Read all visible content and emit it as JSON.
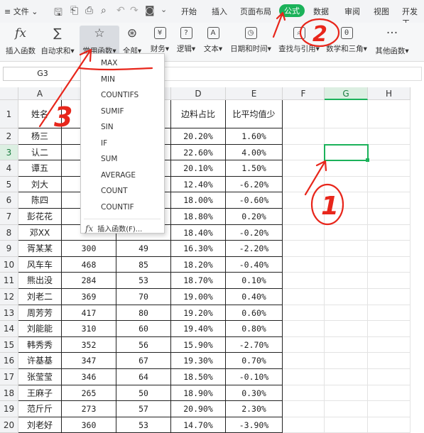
{
  "menubar": {
    "file_label": "文件",
    "tabs": [
      "开始",
      "插入",
      "页面布局",
      "公式",
      "数据",
      "审阅",
      "视图",
      "开发工"
    ],
    "active_tab": "公式"
  },
  "ribbon": {
    "buttons": [
      {
        "label": "插入函数",
        "icon": "fx"
      },
      {
        "label": "自动求和",
        "icon": "∑"
      },
      {
        "label": "常用函数",
        "icon": "☆"
      },
      {
        "label": "全部",
        "icon": "⊛"
      },
      {
        "label": "财务",
        "icon": "¥"
      },
      {
        "label": "逻辑",
        "icon": "?"
      },
      {
        "label": "文本",
        "icon": "A"
      },
      {
        "label": "日期和时间",
        "icon": "◷"
      },
      {
        "label": "查找与引用",
        "icon": "⌕"
      },
      {
        "label": "数学和三角",
        "icon": "θ"
      },
      {
        "label": "其他函数",
        "icon": "···"
      }
    ]
  },
  "formula_bar": {
    "name_box": "G3",
    "formula": ""
  },
  "columns": [
    "A",
    "B",
    "C",
    "D",
    "E",
    "F",
    "G",
    "H"
  ],
  "selected_column": "G",
  "selected_row": "3",
  "headers": {
    "a1": "姓名",
    "d1": "边料占比",
    "e1": "比平均值少"
  },
  "rows": [
    {
      "num": "2",
      "name": "杨三",
      "b": "",
      "c": "",
      "d": "20.20%",
      "e": "1.60%"
    },
    {
      "num": "3",
      "name": "认二",
      "b": "",
      "c": "",
      "d": "22.60%",
      "e": "4.00%"
    },
    {
      "num": "4",
      "name": "谭五",
      "b": "",
      "c": "",
      "d": "20.10%",
      "e": "1.50%"
    },
    {
      "num": "5",
      "name": "刘大",
      "b": "",
      "c": "",
      "d": "12.40%",
      "e": "-6.20%"
    },
    {
      "num": "6",
      "name": "陈四",
      "b": "",
      "c": "",
      "d": "18.00%",
      "e": "-0.60%"
    },
    {
      "num": "7",
      "name": "彭花花",
      "b": "",
      "c": "",
      "d": "18.80%",
      "e": "0.20%"
    },
    {
      "num": "8",
      "name": "邓XX",
      "b": "",
      "c": "",
      "d": "18.40%",
      "e": "-0.20%"
    },
    {
      "num": "9",
      "name": "胥某某",
      "b": "300",
      "c": "49",
      "d": "16.30%",
      "e": "-2.20%"
    },
    {
      "num": "10",
      "name": "风车车",
      "b": "468",
      "c": "85",
      "d": "18.20%",
      "e": "-0.40%"
    },
    {
      "num": "11",
      "name": "熊出没",
      "b": "284",
      "c": "53",
      "d": "18.70%",
      "e": "0.10%"
    },
    {
      "num": "12",
      "name": "刘老二",
      "b": "369",
      "c": "70",
      "d": "19.00%",
      "e": "0.40%"
    },
    {
      "num": "13",
      "name": "周芳芳",
      "b": "417",
      "c": "80",
      "d": "19.20%",
      "e": "0.60%"
    },
    {
      "num": "14",
      "name": "刘能能",
      "b": "310",
      "c": "60",
      "d": "19.40%",
      "e": "0.80%"
    },
    {
      "num": "15",
      "name": "韩秀秀",
      "b": "352",
      "c": "56",
      "d": "15.90%",
      "e": "-2.70%"
    },
    {
      "num": "16",
      "name": "许基基",
      "b": "347",
      "c": "67",
      "d": "19.30%",
      "e": "0.70%"
    },
    {
      "num": "17",
      "name": "张莹莹",
      "b": "346",
      "c": "64",
      "d": "18.50%",
      "e": "-0.10%"
    },
    {
      "num": "18",
      "name": "王麻子",
      "b": "265",
      "c": "50",
      "d": "18.90%",
      "e": "0.30%"
    },
    {
      "num": "19",
      "name": "范斤斤",
      "b": "273",
      "c": "57",
      "d": "20.90%",
      "e": "2.30%"
    },
    {
      "num": "20",
      "name": "刘老好",
      "b": "360",
      "c": "53",
      "d": "14.70%",
      "e": "-3.90%"
    }
  ],
  "dropdown": {
    "items": [
      "MAX",
      "MIN",
      "COUNTIFS",
      "SUMIF",
      "SIN",
      "IF",
      "SUM",
      "AVERAGE",
      "COUNT",
      "COUNTIF"
    ],
    "footer": "插入函数(F)..."
  },
  "annotations": {
    "circle_1": "1",
    "circle_2": "2",
    "circle_3": "3",
    "color": "#e8261b"
  }
}
